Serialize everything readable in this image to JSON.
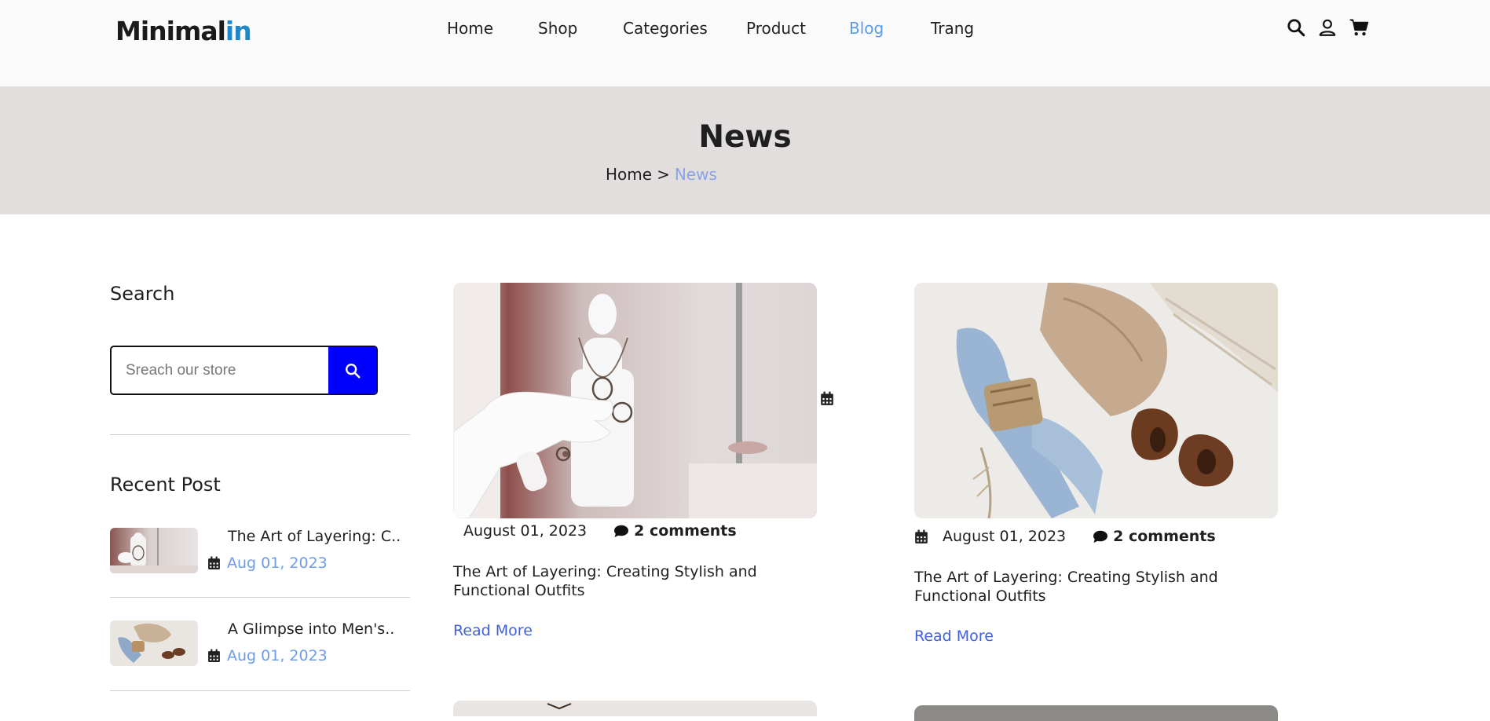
{
  "header": {
    "logo_main": "Minimal",
    "logo_accent": "in",
    "nav": [
      {
        "label": "Home",
        "active": false
      },
      {
        "label": "Shop",
        "active": false
      },
      {
        "label": "Categories",
        "active": false
      },
      {
        "label": "Product",
        "active": false
      },
      {
        "label": "Blog",
        "active": true
      },
      {
        "label": "Trang",
        "active": false
      }
    ],
    "icons": [
      "search-icon",
      "user-icon",
      "cart-icon"
    ]
  },
  "banner": {
    "title": "News",
    "breadcrumb_home": "Home",
    "breadcrumb_sep": ">",
    "breadcrumb_current": "News"
  },
  "sidebar": {
    "search_heading": "Search",
    "search_placeholder": "Sreach our store",
    "recent_heading": "Recent Post",
    "recent_posts": [
      {
        "title": "The Art of Layering: C..",
        "date": "Aug 01, 2023"
      },
      {
        "title": "A Glimpse into Men's..",
        "date": "Aug 01, 2023"
      }
    ]
  },
  "posts": [
    {
      "date": "August 01, 2023",
      "comments": "2 comments",
      "title": "The Art of Layering: Creating Stylish and Functional Outfits",
      "read_more": "Read More"
    },
    {
      "date": "August 01, 2023",
      "comments": "2 comments",
      "title": "The Art of Layering: Creating Stylish and Functional Outfits",
      "read_more": "Read More"
    }
  ],
  "colors": {
    "accent_blue": "#5b9be6",
    "search_button": "#0000ff",
    "banner_bg": "#e3dede",
    "link": "#3f5fe0"
  }
}
